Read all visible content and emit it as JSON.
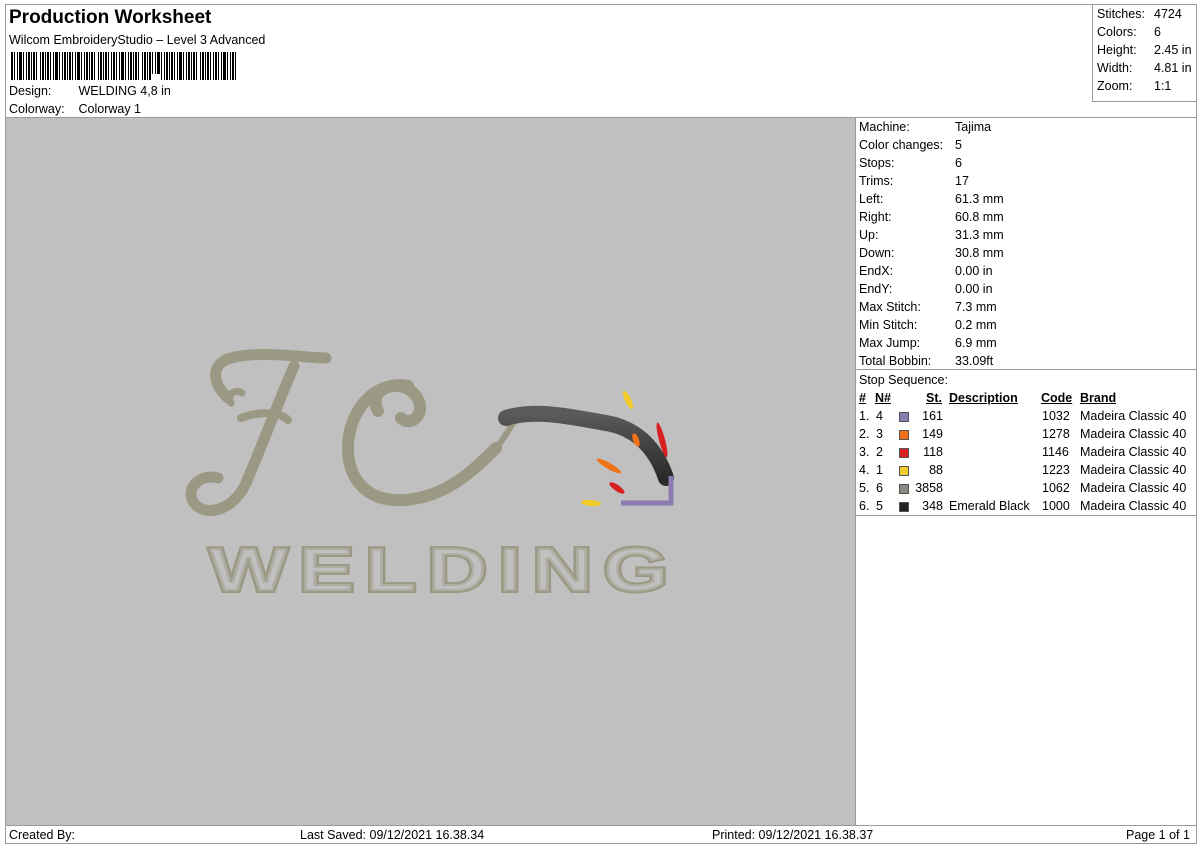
{
  "header": {
    "title": "Production Worksheet",
    "subtitle": "Wilcom EmbroideryStudio – Level 3 Advanced",
    "design_label": "Design:",
    "design_value": "WELDING 4,8 in",
    "colorway_label": "Colorway:",
    "colorway_value": "Colorway 1"
  },
  "summary": [
    {
      "label": "Stitches:",
      "value": "4724"
    },
    {
      "label": "Colors:",
      "value": "6"
    },
    {
      "label": "Height:",
      "value": "2.45 in"
    },
    {
      "label": "Width:",
      "value": "4.81 in"
    },
    {
      "label": "Zoom:",
      "value": "1:1"
    }
  ],
  "machine": [
    {
      "label": "Machine:",
      "value": "Tajima"
    },
    {
      "label": "Color changes:",
      "value": "5"
    },
    {
      "label": "Stops:",
      "value": "6"
    },
    {
      "label": "Trims:",
      "value": "17"
    },
    {
      "label": "Left:",
      "value": "61.3 mm"
    },
    {
      "label": "Right:",
      "value": "60.8 mm"
    },
    {
      "label": "Up:",
      "value": "31.3 mm"
    },
    {
      "label": "Down:",
      "value": "30.8 mm"
    },
    {
      "label": "EndX:",
      "value": "0.00 in"
    },
    {
      "label": "EndY:",
      "value": "0.00 in"
    },
    {
      "label": "Max Stitch:",
      "value": "7.3 mm"
    },
    {
      "label": "Min Stitch:",
      "value": "0.2 mm"
    },
    {
      "label": "Max Jump:",
      "value": "6.9 mm"
    },
    {
      "label": "Total Bobbin:",
      "value": "33.09ft"
    }
  ],
  "stops": {
    "title": "Stop Sequence:",
    "headers": {
      "num": "#",
      "n": "N#",
      "st": "St.",
      "desc": "Description",
      "code": "Code",
      "brand": "Brand"
    },
    "rows": [
      {
        "idx": "1.",
        "n": "4",
        "color": "#8b7bb0",
        "st": "161",
        "desc": "",
        "code": "1032",
        "brand": "Madeira Classic 40"
      },
      {
        "idx": "2.",
        "n": "3",
        "color": "#f07318",
        "st": "149",
        "desc": "",
        "code": "1278",
        "brand": "Madeira Classic 40"
      },
      {
        "idx": "3.",
        "n": "2",
        "color": "#d92020",
        "st": "118",
        "desc": "",
        "code": "1146",
        "brand": "Madeira Classic 40"
      },
      {
        "idx": "4.",
        "n": "1",
        "color": "#f1cc2a",
        "st": "88",
        "desc": "",
        "code": "1223",
        "brand": "Madeira Classic 40"
      },
      {
        "idx": "5.",
        "n": "6",
        "color": "#8c8a80",
        "st": "3858",
        "desc": "",
        "code": "1062",
        "brand": "Madeira Classic 40"
      },
      {
        "idx": "6.",
        "n": "5",
        "color": "#222222",
        "st": "348",
        "desc": "Emerald Black",
        "code": "1000",
        "brand": "Madeira Classic 40"
      }
    ]
  },
  "design": {
    "monogram": "FC",
    "word": "WELDING",
    "thread_color": "#9b9983",
    "background": "#c0c0c0"
  },
  "footer": {
    "created": "Created By:",
    "saved": "Last Saved: 09/12/2021 16.38.34",
    "printed": "Printed: 09/12/2021 16.38.37",
    "page": "Page 1 of 1"
  }
}
